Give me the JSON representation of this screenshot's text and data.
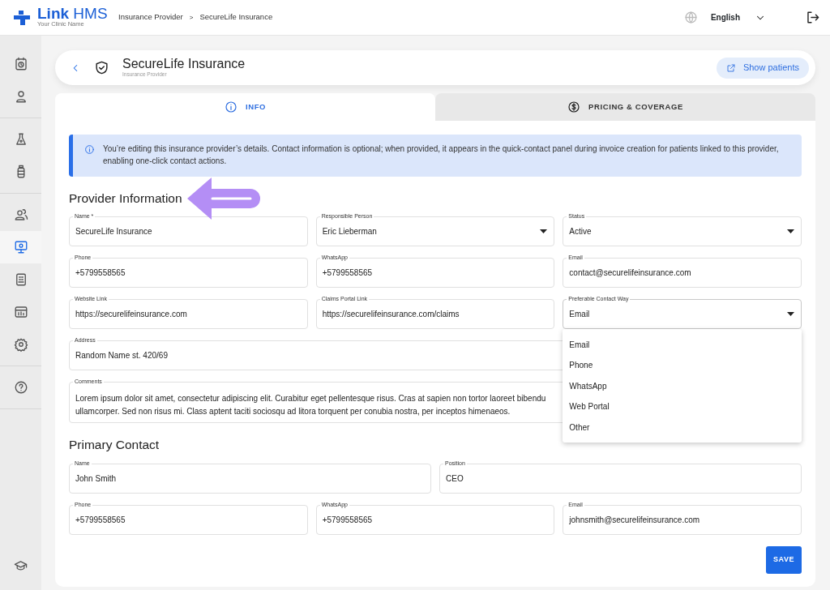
{
  "header": {
    "logo": "**Link** HMS",
    "clinic": "Your Clinic Name",
    "breadcrumbs": [
      "Insurance Provider",
      "SecureLife Insurance"
    ],
    "breadcrumb_separator": ">",
    "language": "English"
  },
  "sidebar": {
    "groups": [
      [
        {
          "selected": false
        },
        {
          "selected": false
        }
      ],
      [
        {
          "selected": false
        },
        {
          "selected": false
        }
      ],
      [
        {
          "selected": false
        },
        {
          "selected": true
        },
        {
          "selected": false
        },
        {
          "selected": false
        },
        {
          "selected": false
        }
      ],
      [
        {
          "selected": false
        }
      ]
    ],
    "bottom": [
      {
        "selected": false
      }
    ]
  },
  "title_card": {
    "title": "SecureLife Insurance",
    "subtitle": "Insurance Provider",
    "button": "Show patients"
  },
  "tabs": [
    {
      "label": "INFO",
      "selected": true
    },
    {
      "label": "PRICING & COVERAGE",
      "selected": false
    }
  ],
  "alert": "You’re editing this insurance provider’s details. Contact information is optional; when provided, it appears in the quick-contact panel during invoice creation for patients linked to this provider, enabling one-click contact actions.",
  "sections": [
    {
      "title": "Provider Information",
      "pointer_arrow": true,
      "rows": [
        [
          {
            "kind": "text",
            "label": "Name *",
            "value": "SecureLife Insurance"
          },
          {
            "kind": "select",
            "label": "Responsible Person",
            "value": "Eric Lieberman"
          },
          {
            "kind": "select",
            "label": "Status",
            "value": "Active"
          }
        ],
        [
          {
            "kind": "text",
            "label": "Phone",
            "value": "+5799558565"
          },
          {
            "kind": "text",
            "label": "WhatsApp",
            "value": "+5799558565"
          },
          {
            "kind": "text",
            "label": "Email",
            "value": "contact@securelifeinsurance.com"
          }
        ],
        [
          {
            "kind": "text",
            "label": "Website Link",
            "value": "https://securelifeinsurance.com"
          },
          {
            "kind": "text",
            "label": "Claims Portal Link",
            "value": "https://securelifeinsurance.com/claims"
          },
          {
            "kind": "select",
            "label": "Preferable Contact Way",
            "value": "Email",
            "expanded": true,
            "options": [
              "Email",
              "Phone",
              "WhatsApp",
              "Web Portal",
              "Other"
            ]
          }
        ],
        [
          {
            "kind": "text",
            "label": "Address",
            "value": "Random Name st. 420/69"
          }
        ],
        [
          {
            "kind": "textarea",
            "label": "Comments",
            "lines": [
              "Lorem ipsum dolor sit amet, consectetur adipiscing elit. Curabitur eget pellentesque risus. Cras at sapien non tortor laoreet bibendu",
              "ullamcorper. Sed non risus mi. Class aptent taciti sociosqu ad litora torquent per conubia nostra, per inceptos himenaeos."
            ]
          }
        ]
      ]
    },
    {
      "title": "Primary Contact",
      "rows": [
        [
          {
            "kind": "text",
            "label": "Name",
            "value": "John Smith"
          },
          {
            "kind": "text",
            "label": "Position",
            "value": "CEO"
          }
        ],
        [
          {
            "kind": "text",
            "label": "Phone",
            "value": "+5799558565"
          },
          {
            "kind": "text",
            "label": "WhatsApp",
            "value": "+5799558565"
          },
          {
            "kind": "text",
            "label": "Email",
            "value": "johnsmith@securelifeinsurance.com"
          }
        ]
      ]
    }
  ],
  "save_button": "SAVE"
}
